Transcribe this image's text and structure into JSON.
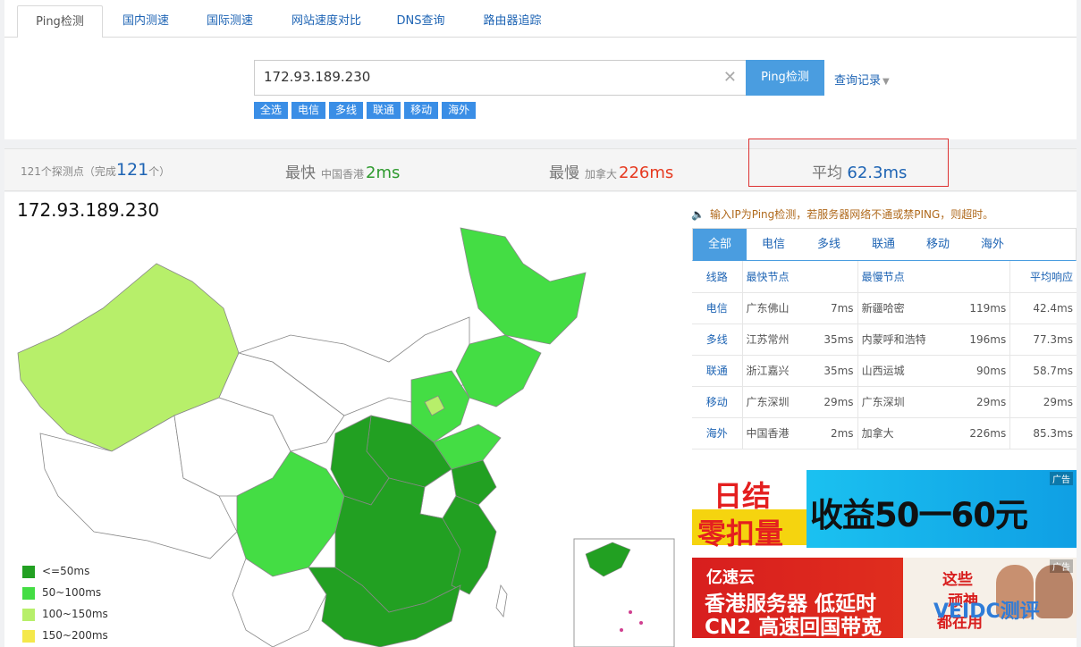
{
  "tabs": [
    "Ping检测",
    "国内测速",
    "国际测速",
    "网站速度对比",
    "DNS查询",
    "路由器追踪"
  ],
  "search": {
    "value": "172.93.189.230",
    "clear_icon": "close-icon",
    "button": "Ping检测",
    "history": "查询记录"
  },
  "filters": [
    "全选",
    "电信",
    "多线",
    "联通",
    "移动",
    "海外"
  ],
  "summary": {
    "probes_prefix": "121个探测点（完成",
    "probes_done": "121",
    "probes_suffix": "个）",
    "fastest_label": "最快",
    "fastest_loc": "中国香港",
    "fastest_val": "2ms",
    "slowest_label": "最慢",
    "slowest_loc": "加拿大",
    "slowest_val": "226ms",
    "avg_label": "平均",
    "avg_val": "62.3ms"
  },
  "main": {
    "ip_title": "172.93.189.230"
  },
  "legend": [
    {
      "label": "<=50ms",
      "color": "#22a022"
    },
    {
      "label": "50~100ms",
      "color": "#44dd44"
    },
    {
      "label": "100~150ms",
      "color": "#b7ef6a"
    },
    {
      "label": "150~200ms",
      "color": "#f4e84a"
    }
  ],
  "hint": "输入IP为Ping检测，若服务器网络不通或禁PING，则超时。",
  "result_tabs": [
    "全部",
    "电信",
    "多线",
    "联通",
    "移动",
    "海外"
  ],
  "table": {
    "headers": [
      "线路",
      "最快节点",
      "最慢节点",
      "平均响应"
    ],
    "rows": [
      {
        "line": "电信",
        "fast_node": "广东佛山",
        "fast_ms": "7ms",
        "slow_node": "新疆哈密",
        "slow_ms": "119ms",
        "avg": "42.4ms"
      },
      {
        "line": "多线",
        "fast_node": "江苏常州",
        "fast_ms": "35ms",
        "slow_node": "内蒙呼和浩特",
        "slow_ms": "196ms",
        "avg": "77.3ms"
      },
      {
        "line": "联通",
        "fast_node": "浙江嘉兴",
        "fast_ms": "35ms",
        "slow_node": "山西运城",
        "slow_ms": "90ms",
        "avg": "58.7ms"
      },
      {
        "line": "移动",
        "fast_node": "广东深圳",
        "fast_ms": "29ms",
        "slow_node": "广东深圳",
        "slow_ms": "29ms",
        "avg": "29ms"
      },
      {
        "line": "海外",
        "fast_node": "中国香港",
        "fast_ms": "2ms",
        "slow_node": "加拿大",
        "slow_ms": "226ms",
        "avg": "85.3ms"
      }
    ]
  },
  "ads": {
    "tag": "广告",
    "ad1": {
      "l1": "日结",
      "l2": "零扣量",
      "right": "收益50一60元"
    },
    "ad2": {
      "brand": "亿速云",
      "t1": "香港服务器 低延时",
      "t2": "CN2 高速回国带宽",
      "promo1": "这些",
      "promo2": "顽神",
      "promo3": "都在用",
      "watermark": "VEIDC测评"
    }
  }
}
